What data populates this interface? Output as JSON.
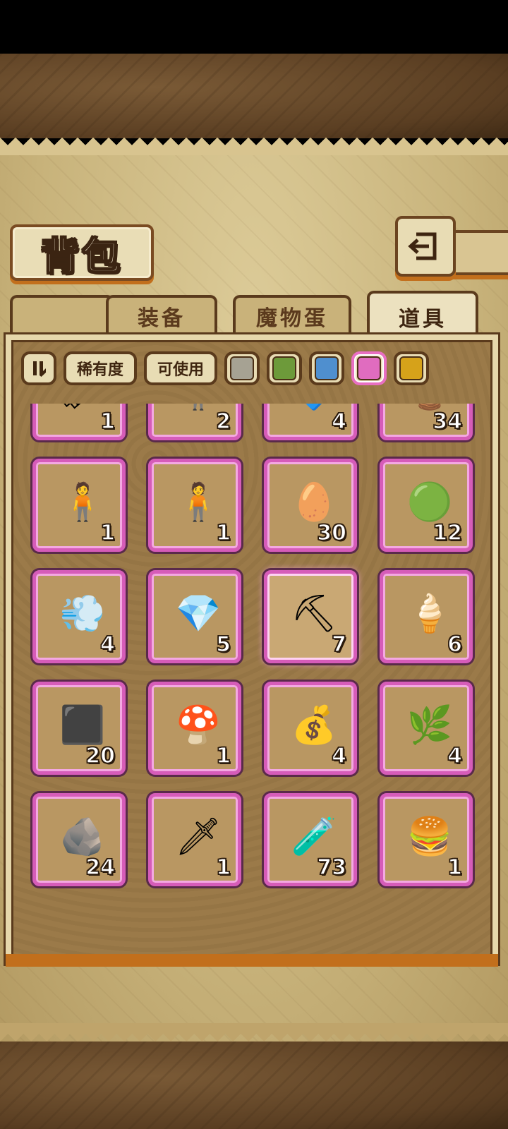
{
  "header": {
    "title": "背包"
  },
  "tabs": [
    {
      "label": "装备",
      "active": false
    },
    {
      "label": "魔物蛋",
      "active": false
    },
    {
      "label": "道具",
      "active": true
    }
  ],
  "filters": {
    "sort_icon": "pause-sort-icon",
    "rarity_label": "稀有度",
    "usable_label": "可使用",
    "colors": [
      "#a6a293",
      "#6d9a3a",
      "#4f8fcf",
      "#e06cbf",
      "#d6a21a"
    ],
    "selected_color_index": 3
  },
  "items": [
    {
      "name": "gold-key-statue",
      "glyph": "🗝",
      "count": "1"
    },
    {
      "name": "brown-hair-figurine",
      "glyph": "🧍",
      "count": "2"
    },
    {
      "name": "blue-crystal-shard",
      "glyph": "🔷",
      "count": "4"
    },
    {
      "name": "rune-crystal",
      "glyph": "🔮",
      "count": "34"
    },
    {
      "name": "black-hair-figurine",
      "glyph": "🧍",
      "count": "1"
    },
    {
      "name": "pink-hair-figurine",
      "glyph": "🧍",
      "count": "1"
    },
    {
      "name": "rainbow-egg",
      "glyph": "🥚",
      "count": "30"
    },
    {
      "name": "green-slime",
      "glyph": "🟢",
      "count": "12"
    },
    {
      "name": "dark-smoke",
      "glyph": "💨",
      "count": "4"
    },
    {
      "name": "blue-gem",
      "glyph": "💎",
      "count": "5"
    },
    {
      "name": "pickaxe",
      "glyph": "⛏",
      "count": "7"
    },
    {
      "name": "cream-bowl",
      "glyph": "🍦",
      "count": "6"
    },
    {
      "name": "iron-ingot",
      "glyph": "⬛",
      "count": "20"
    },
    {
      "name": "mushroom-girl-figurine",
      "glyph": "🍄",
      "count": "1"
    },
    {
      "name": "gold-sack",
      "glyph": "💰",
      "count": "4"
    },
    {
      "name": "herb-sprig",
      "glyph": "🌿",
      "count": "4"
    },
    {
      "name": "silver-shard",
      "glyph": "🪨",
      "count": "24"
    },
    {
      "name": "dark-sword",
      "glyph": "🗡",
      "count": "1"
    },
    {
      "name": "purple-potion",
      "glyph": "🧪",
      "count": "73"
    },
    {
      "name": "burger-figurine",
      "glyph": "🍔",
      "count": "1"
    }
  ],
  "highlighted_item_index": 10
}
